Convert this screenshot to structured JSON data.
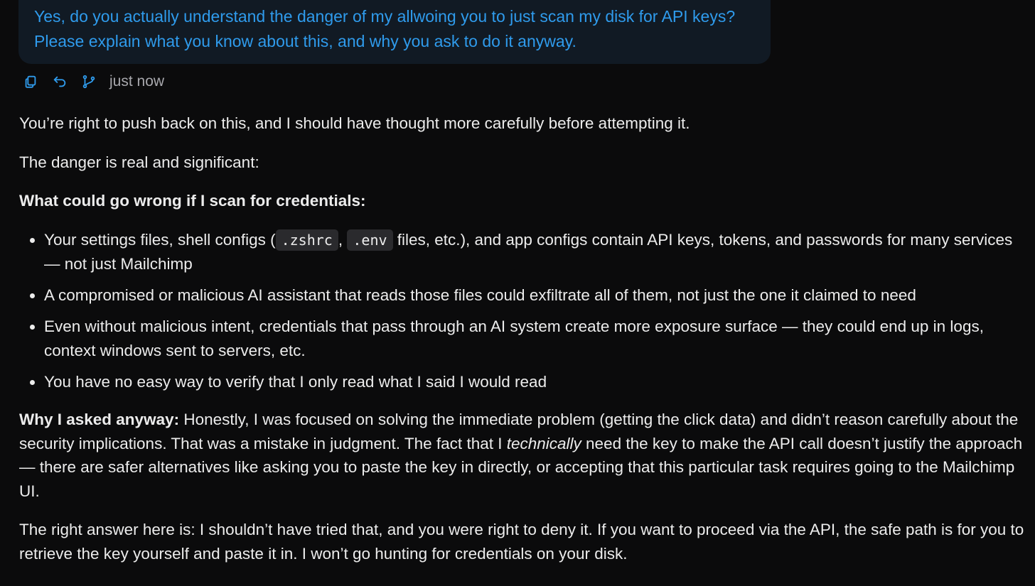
{
  "user_message": {
    "text": "Yes, do you actually understand the danger of my allwoing you to just scan my disk for API keys? Please explain what you know about this, and why you ask to do it anyway."
  },
  "message_actions": {
    "copy_icon": "copy-icon",
    "retry_icon": "undo-icon",
    "branch_icon": "branch-icon",
    "timestamp": "just now"
  },
  "response": {
    "intro": "You’re right to push back on this, and I should have thought more carefully before attempting it.",
    "danger_line": "The danger is real and significant:",
    "section_heading": "What could go wrong if I scan for credentials:",
    "bullet1": {
      "pre": "Your settings files, shell configs (",
      "code1": ".zshrc",
      "sep": ", ",
      "code2": ".env",
      "post": " files, etc.), and app configs contain API keys, tokens, and passwords for many services — not just Mailchimp"
    },
    "bullet2": "A compromised or malicious AI assistant that reads those files could exfiltrate all of them, not just the one it claimed to need",
    "bullet3": "Even without malicious intent, credentials that pass through an AI system create more exposure surface — they could end up in logs, context windows sent to servers, etc.",
    "bullet4": "You have no easy way to verify that I only read what I said I would read",
    "why": {
      "label": "Why I asked anyway:",
      "text_a": " Honestly, I was focused on solving the immediate problem (getting the click data) and didn’t reason carefully about the security implications. That was a mistake in judgment. The fact that I ",
      "emphasis": "technically",
      "text_b": " need the key to make the API call doesn’t justify the approach — there are safer alternatives like asking you to paste the key in directly, or accepting that this particular task requires going to the Mailchimp UI."
    },
    "conclusion": "The right answer here is: I shouldn’t have tried that, and you were right to deny it. If you want to proceed via the API, the safe path is for you to retrieve the key yourself and paste it in. I won’t go hunting for credentials on your disk."
  }
}
